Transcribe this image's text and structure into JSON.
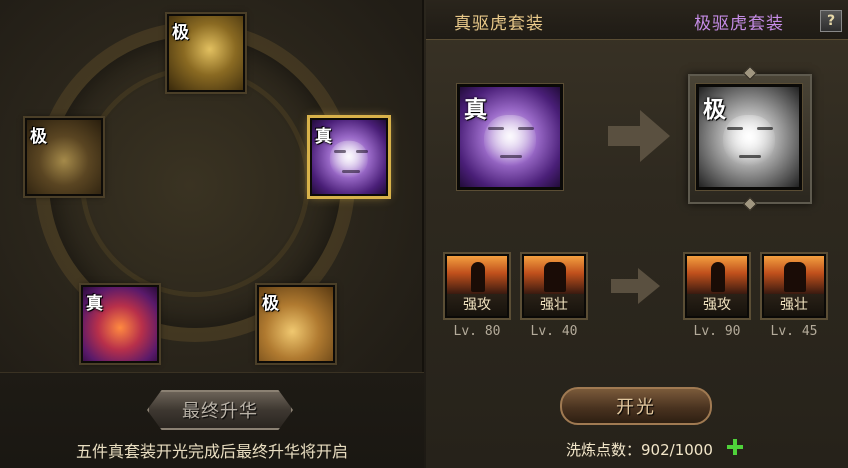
{
  "left_panel": {
    "slots": [
      {
        "id": "top",
        "tag": "极",
        "item": "gold-dragon",
        "selected": false
      },
      {
        "id": "left",
        "tag": "极",
        "item": "gold-beast",
        "selected": false
      },
      {
        "id": "right",
        "tag": "真",
        "item": "purple-tiger",
        "selected": true
      },
      {
        "id": "bottom-left",
        "tag": "真",
        "item": "phoenix",
        "selected": false
      },
      {
        "id": "bottom-right",
        "tag": "极",
        "item": "gold-tortoise",
        "selected": false
      }
    ],
    "final_upgrade_button": "最终升华",
    "final_upgrade_note": "五件真套装开光完成后最终升华将开启"
  },
  "right_panel": {
    "tab_current": "真驱虎套装",
    "tab_target": "极驱虎套装",
    "help_label": "?",
    "current_item": {
      "tag": "真",
      "item": "purple-tiger"
    },
    "target_item": {
      "tag": "极",
      "item": "grey-tiger"
    },
    "skills_current": [
      {
        "name": "强攻",
        "level": "Lv. 80"
      },
      {
        "name": "强壮",
        "level": "Lv. 40"
      }
    ],
    "skills_target": [
      {
        "name": "强攻",
        "level": "Lv. 90"
      },
      {
        "name": "强壮",
        "level": "Lv. 45"
      }
    ],
    "open_button": "开光",
    "points_label": "洗炼点数：",
    "points_value": "902/1000"
  },
  "colors": {
    "tab_current": "#e9c98a",
    "tab_target": "#c58ce6",
    "selected_outline": "#d8b24a",
    "plus": "#4fd23a"
  }
}
